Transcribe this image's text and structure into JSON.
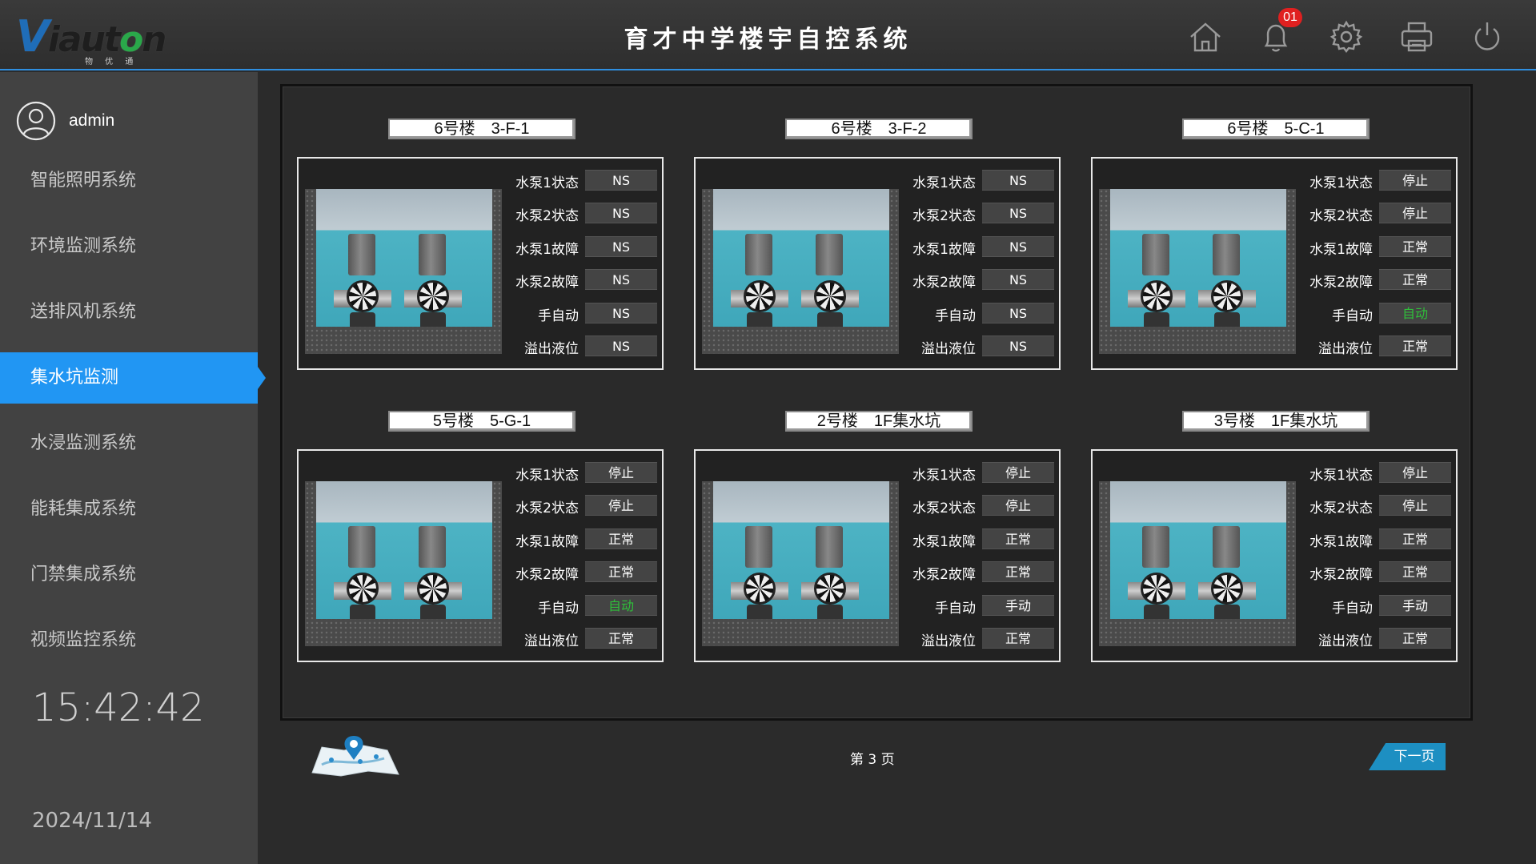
{
  "header": {
    "logo_text": "Viauton",
    "logo_sub": "物 优 通",
    "title": "育才中学楼宇自控系统",
    "notification_count": "01",
    "icons": [
      "home-icon",
      "bell-icon",
      "gear-icon",
      "printer-icon",
      "power-icon"
    ]
  },
  "sidebar": {
    "username": "admin",
    "items": [
      {
        "label": "智能照明系统"
      },
      {
        "label": "环境监测系统"
      },
      {
        "label": "送排风机系统"
      },
      {
        "label": "集水坑监测"
      },
      {
        "label": "水浸监测系统"
      },
      {
        "label": "能耗集成系统"
      },
      {
        "label": "门禁集成系统"
      },
      {
        "label": "视频监控系统"
      }
    ],
    "active_index": 3,
    "time": "15:42:42",
    "date": "2024/11/14"
  },
  "status_labels": [
    "水泵1状态",
    "水泵2状态",
    "水泵1故障",
    "水泵2故障",
    "手自动",
    "溢出液位"
  ],
  "units": [
    {
      "title": "6号楼　3-F-1",
      "values": [
        "NS",
        "NS",
        "NS",
        "NS",
        "NS",
        "NS"
      ]
    },
    {
      "title": "6号楼　3-F-2",
      "values": [
        "NS",
        "NS",
        "NS",
        "NS",
        "NS",
        "NS"
      ]
    },
    {
      "title": "6号楼　5-C-1",
      "values": [
        "停止",
        "停止",
        "正常",
        "正常",
        "自动",
        "正常"
      ]
    },
    {
      "title": "5号楼　5-G-1",
      "values": [
        "停止",
        "停止",
        "正常",
        "正常",
        "自动",
        "正常"
      ]
    },
    {
      "title": "2号楼　1F集水坑",
      "values": [
        "停止",
        "停止",
        "正常",
        "正常",
        "手动",
        "正常"
      ]
    },
    {
      "title": "3号楼　1F集水坑",
      "values": [
        "停止",
        "停止",
        "正常",
        "正常",
        "手动",
        "正常"
      ]
    }
  ],
  "pagination": {
    "page_prefix": "第",
    "page_number": "3",
    "page_suffix": "页",
    "next_label": "下一页"
  },
  "colors": {
    "accent": "#2196f3",
    "auto_status": "#2fbf3a",
    "badge": "#e02020"
  }
}
